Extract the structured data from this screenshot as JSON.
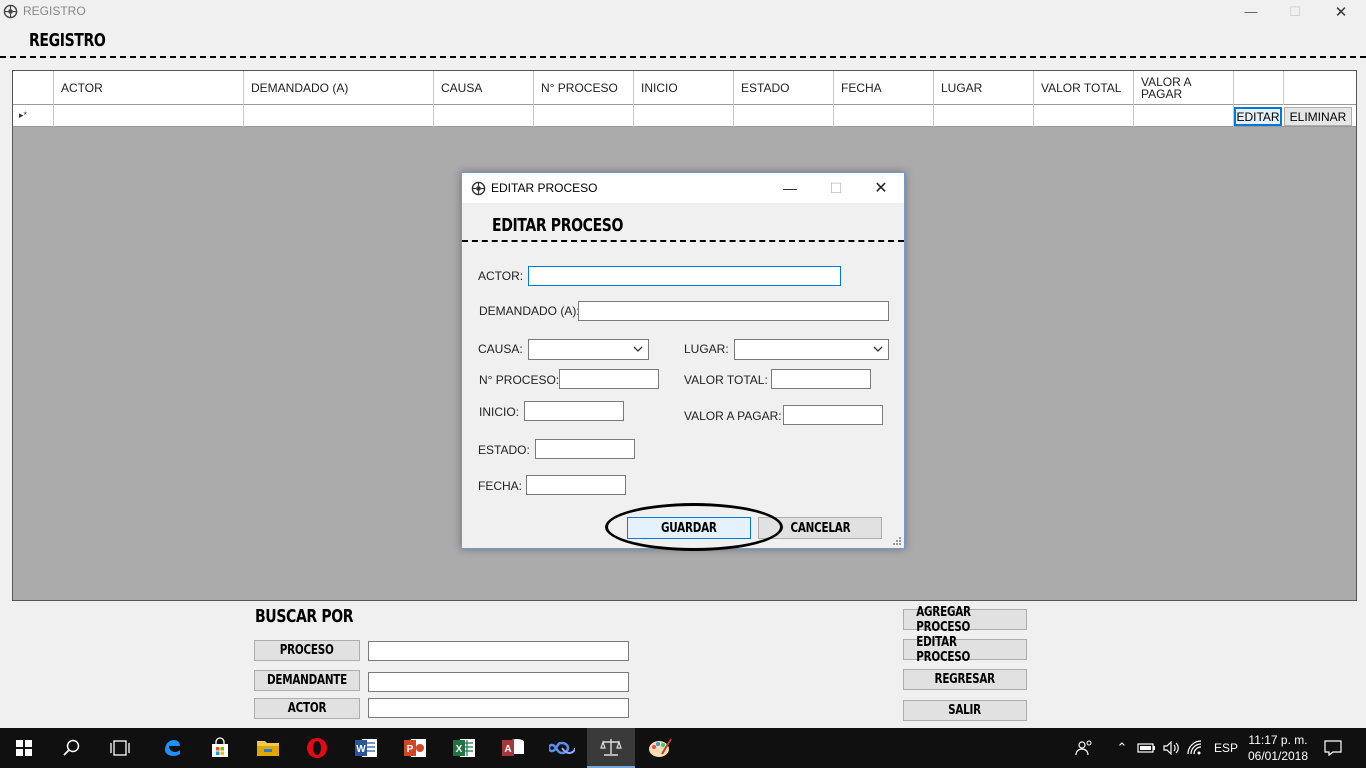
{
  "window": {
    "title": "REGISTRO"
  },
  "heading": "REGISTRO",
  "grid": {
    "columns": [
      "ACTOR",
      "DEMANDADO (A)",
      "CAUSA",
      "N° PROCESO",
      "INICIO",
      "ESTADO",
      "FECHA",
      "LUGAR",
      "VALOR TOTAL",
      "VALOR A PAGAR"
    ],
    "row_marker": "▸*",
    "editar_label": "EDITAR",
    "eliminar_label": "ELIMINAR"
  },
  "dialog": {
    "title": "EDITAR PROCESO",
    "heading": "EDITAR PROCESO",
    "labels": {
      "actor": "ACTOR:",
      "demandado": "DEMANDADO (A):",
      "causa": "CAUSA:",
      "lugar": "LUGAR:",
      "n_proceso": "N° PROCESO:",
      "valor_total": "VALOR TOTAL:",
      "inicio": "INICIO:",
      "valor_pagar": "VALOR A PAGAR:",
      "estado": "ESTADO:",
      "fecha": "FECHA:"
    },
    "values": {
      "actor": "",
      "demandado": "",
      "causa": "",
      "lugar": "",
      "n_proceso": "",
      "valor_total": "",
      "inicio": "",
      "valor_pagar": "",
      "estado": "",
      "fecha": ""
    },
    "guardar_label": "GUARDAR",
    "cancelar_label": "CANCELAR"
  },
  "search": {
    "title": "BUSCAR POR",
    "buttons": {
      "proceso": "PROCESO",
      "demandante": "DEMANDANTE",
      "actor": "ACTOR"
    },
    "values": {
      "proceso": "",
      "demandante": "",
      "actor": ""
    }
  },
  "actions": {
    "agregar": "AGREGAR PROCESO",
    "editar": "EDITAR PROCESO",
    "regresar": "REGRESAR",
    "salir": "SALIR"
  },
  "taskbar": {
    "language": "ESP",
    "time": "11:17 p. m.",
    "date": "06/01/2018",
    "icons": [
      "windows-start-icon",
      "search-icon",
      "task-view-icon",
      "edge-icon",
      "store-icon",
      "file-explorer-icon",
      "opera-icon",
      "word-icon",
      "powerpoint-icon",
      "excel-icon",
      "access-icon",
      "infinity-app-icon",
      "scales-app-icon",
      "paint-icon"
    ]
  },
  "colors": {
    "accent": "#0078d7",
    "grid_bg": "#ababab",
    "taskbar": "#101010"
  }
}
